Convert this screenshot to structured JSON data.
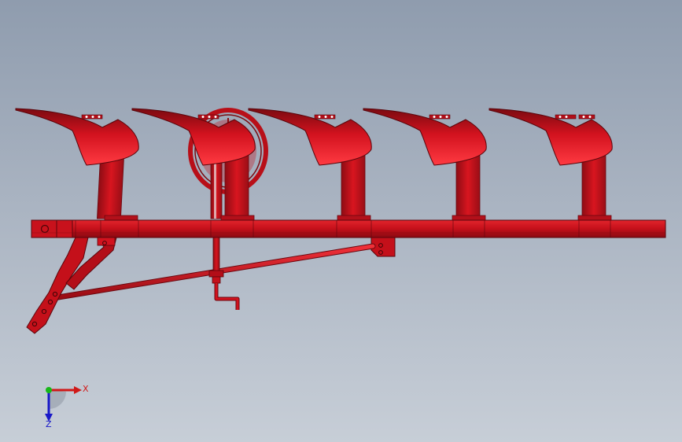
{
  "viewport": {
    "accent_color": "#d2121e",
    "dark_color": "#7a0a10",
    "highlight_color": "#ff4a50"
  },
  "model": {
    "name": "five-bottom-plough-assembly",
    "bottom_count": 5
  },
  "triad": {
    "x_label": "X",
    "z_label": "Z",
    "x_color": "#d01818",
    "y_color": "#18b818",
    "z_color": "#1818c8"
  }
}
